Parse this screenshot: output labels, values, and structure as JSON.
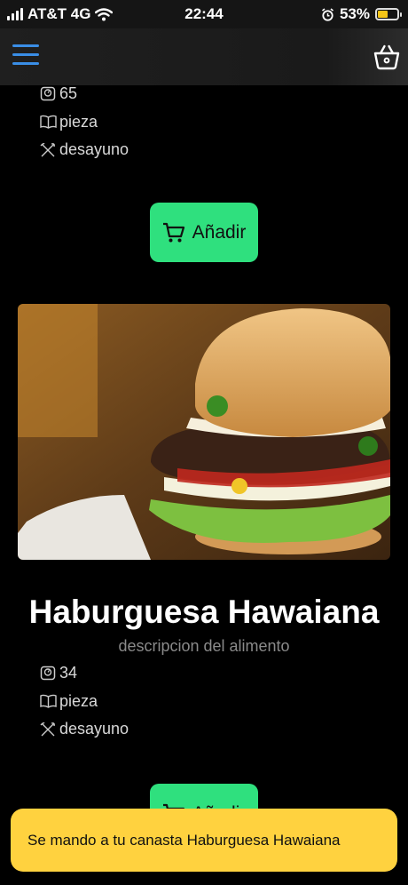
{
  "status_bar": {
    "carrier": "AT&T 4G",
    "time": "22:44",
    "battery": "53%",
    "battery_level": 0.53
  },
  "header": {
    "menu_icon": "hamburger-menu-icon",
    "basket_icon": "basket-icon"
  },
  "items": [
    {
      "quantity": "65",
      "unit": "pieza",
      "category": "desayuno",
      "add_label": "Añadir"
    },
    {
      "title": "Haburguesa Hawaiana",
      "description": "descripcion del alimento",
      "quantity": "34",
      "unit": "pieza",
      "category": "desayuno",
      "add_label": "Añadir"
    }
  ],
  "toast": {
    "message": "Se mando a tu canasta Haburguesa Hawaiana"
  },
  "colors": {
    "accent_green": "#2fe07e",
    "toast_yellow": "#ffd23f",
    "menu_blue": "#3a8ee6"
  }
}
